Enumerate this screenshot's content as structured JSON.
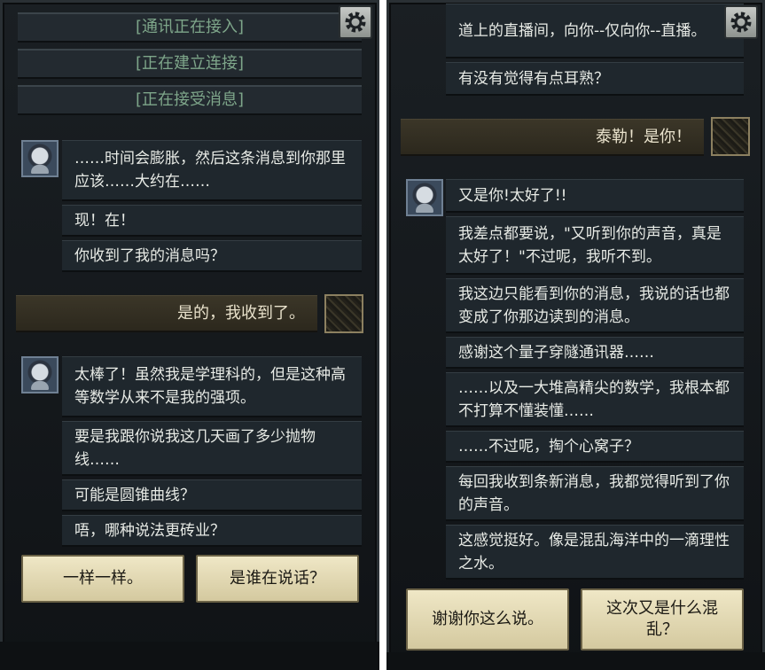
{
  "left": {
    "system_lines": [
      "[通讯正在接入]",
      "[正在建立连接]",
      "[正在接受消息]"
    ],
    "group1": [
      "……时间会膨胀，然后这条消息到你那里应该……大约在……",
      "现！在！",
      "你收到了我的消息吗？"
    ],
    "reply": "是的，我收到了。",
    "group2": [
      "太棒了！虽然我是学理科的，但是这种高等数学从来不是我的强项。",
      "要是我跟你说我这几天画了多少抛物线……",
      "可能是圆锥曲线？",
      "唔，哪种说法更砖业？"
    ],
    "choices": [
      "一样一样。",
      "是谁在说话？"
    ]
  },
  "right": {
    "group0": [
      "道上的直播间，向你--仅向你--直播。",
      "有没有觉得有点耳熟？"
    ],
    "reply": "泰勒！是你！",
    "group1": [
      "又是你!太好了!!",
      "我差点都要说，\"又听到你的声音，真是太好了！\"不过呢，我听不到。",
      "我这边只能看到你的消息，我说的话也都变成了你那边读到的消息。",
      "感谢这个量子穿隧通讯器……",
      "……以及一大堆高精尖的数学，我根本都不打算不懂装懂……",
      "……不过呢，掏个心窝子？",
      "每回我收到条新消息，我都觉得听到了你的声音。",
      "这感觉挺好。像是混乱海洋中的一滴理性之水。"
    ],
    "choices": [
      "谢谢你这么说。",
      "这次又是什么混乱？"
    ]
  },
  "icons": {
    "settings": "gear-icon",
    "npc_avatar": "astronaut-avatar",
    "player_avatar": "player-portrait"
  },
  "colors": {
    "system_text": "#7ea68a",
    "bubble_bg": "#1f272d",
    "reply_bg": "#3b3628",
    "choice_bg": "#efe7c6"
  }
}
